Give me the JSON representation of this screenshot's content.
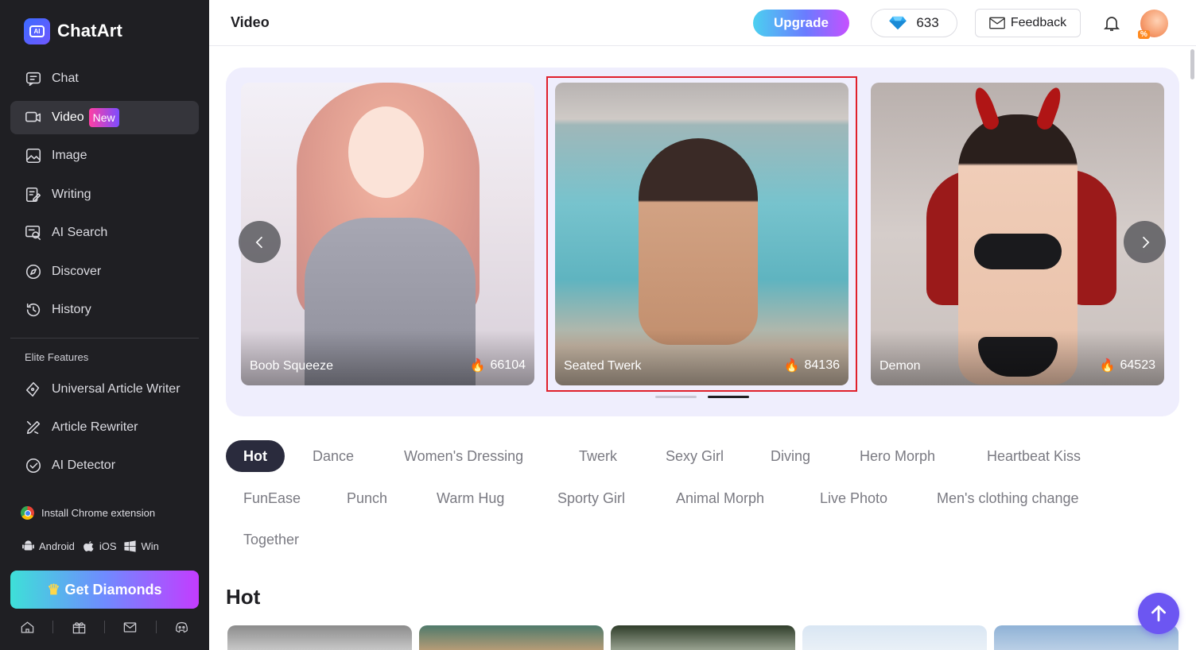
{
  "brand": {
    "name": "ChatArt"
  },
  "nav": [
    {
      "label": "Chat",
      "icon": "chat-icon"
    },
    {
      "label": "Video",
      "icon": "video-icon",
      "badge": "New",
      "active": true
    },
    {
      "label": "Image",
      "icon": "image-icon"
    },
    {
      "label": "Writing",
      "icon": "writing-icon"
    },
    {
      "label": "AI Search",
      "icon": "ai-search-icon"
    },
    {
      "label": "Discover",
      "icon": "compass-icon"
    },
    {
      "label": "History",
      "icon": "history-icon"
    }
  ],
  "elite": {
    "title": "Elite Features",
    "items": [
      {
        "label": "Universal Article Writer",
        "icon": "pen-icon"
      },
      {
        "label": "Article Rewriter",
        "icon": "rewrite-icon"
      },
      {
        "label": "AI Detector",
        "icon": "detector-icon"
      }
    ]
  },
  "extension": {
    "label": "Install Chrome extension",
    "icon": "chrome-icon"
  },
  "platforms": [
    {
      "label": "Android",
      "icon": "android-icon"
    },
    {
      "label": "iOS",
      "icon": "apple-icon"
    },
    {
      "label": "Win",
      "icon": "windows-icon"
    }
  ],
  "get_diamonds": {
    "label": "Get Diamonds",
    "icon": "crown-icon"
  },
  "bottom_icons": [
    "home-icon",
    "gift-icon",
    "mail-icon",
    "discord-icon"
  ],
  "header": {
    "title": "Video",
    "upgrade_label": "Upgrade",
    "diamonds": "633",
    "feedback_label": "Feedback"
  },
  "carousel": {
    "cards": [
      {
        "label": "Boob Squeeze",
        "count": "66104"
      },
      {
        "label": "Seated Twerk",
        "count": "84136",
        "highlighted": true
      },
      {
        "label": "Demon",
        "count": "64523"
      }
    ],
    "active_dot": 2
  },
  "tabs": [
    "Hot",
    "Dance",
    "Women's Dressing",
    "Twerk",
    "Sexy Girl",
    "Diving",
    "Hero Morph",
    "Heartbeat Kiss",
    "FunEase",
    "Punch",
    "Warm Hug",
    "Sporty Girl",
    "Animal Morph",
    "Live Photo",
    "Men's clothing change",
    "Together"
  ],
  "active_tab": "Hot",
  "section": {
    "title": "Hot"
  },
  "colors": {
    "accent": "#6c56f2",
    "sidebar": "#1f1f23",
    "highlight_border": "#e0202b"
  }
}
